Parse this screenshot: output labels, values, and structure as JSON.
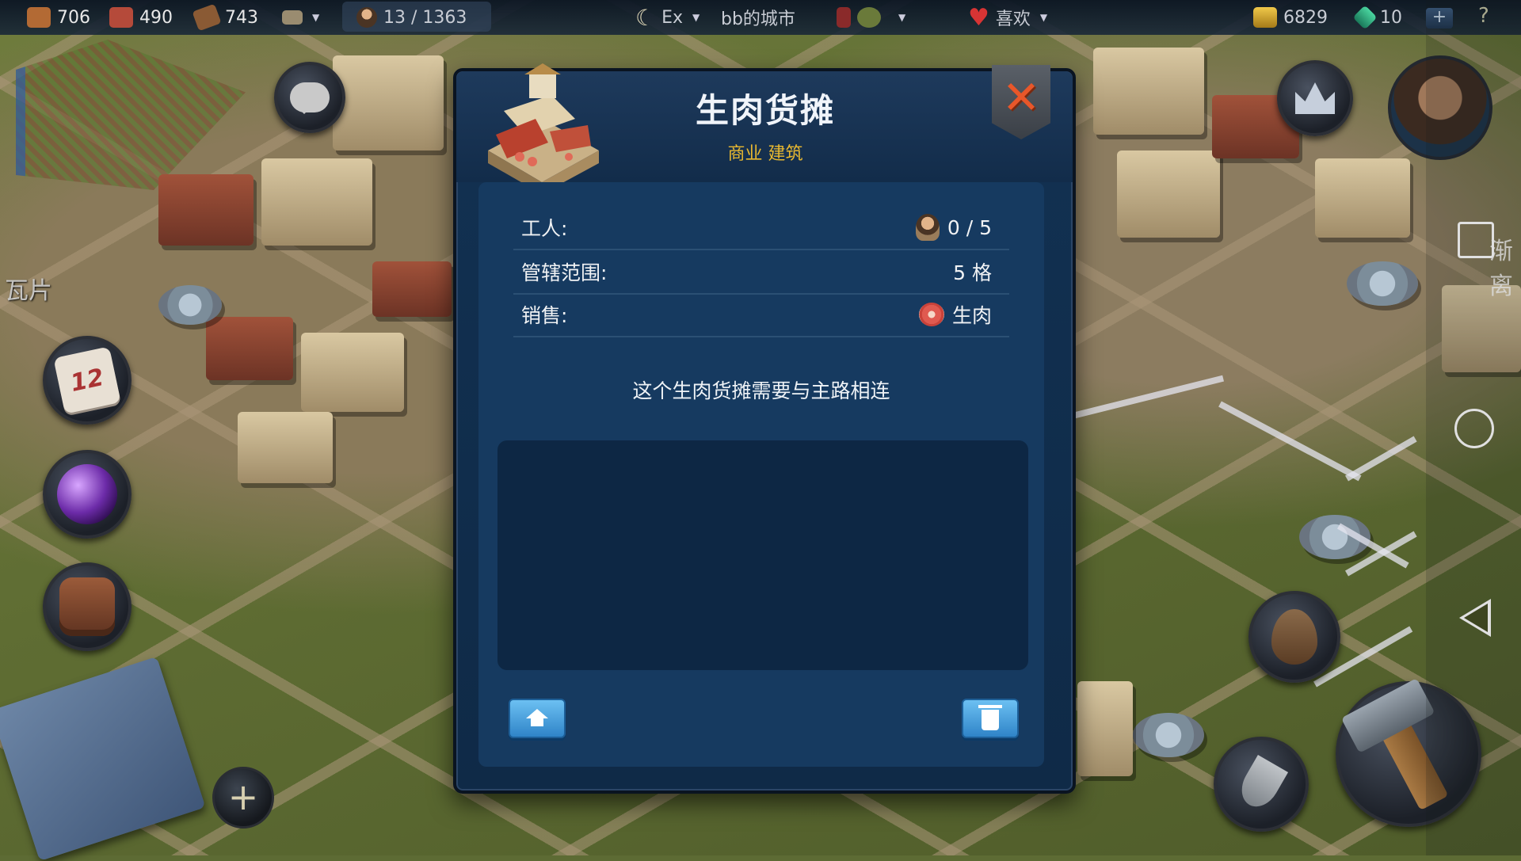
{
  "topbar": {
    "resources": [
      {
        "name": "wood-crate",
        "value": "706",
        "color": "#b36a34"
      },
      {
        "name": "brick",
        "value": "490",
        "color": "#b54a3a"
      },
      {
        "name": "log",
        "value": "743",
        "color": "#8a5a34"
      }
    ],
    "population": "13 / 1363",
    "difficulty": "Ex",
    "city_name": "bb的城市",
    "mood": "喜欢",
    "gold": "6829",
    "gems": "10",
    "add_label": "+",
    "help_label": "?"
  },
  "map": {
    "edge_label_left": "瓦片",
    "edge_label_right": "渐离"
  },
  "left_buttons": {
    "calendar_day": "12",
    "add_label": "+"
  },
  "dialog": {
    "title": "生肉货摊",
    "subtitle": "商业 建筑",
    "rows": [
      {
        "label": "工人:",
        "value": "0 / 5",
        "icon": "worker-icon"
      },
      {
        "label": "管辖范围:",
        "value": "5 格",
        "icon": ""
      },
      {
        "label": "销售:",
        "value": "生肉",
        "icon": "meat-icon"
      }
    ],
    "notice": "这个生肉货摊需要与主路相连",
    "close_glyph": "✕"
  },
  "colors": {
    "accent_gold": "#e8b830",
    "dialog_bg": "#123152",
    "close_orange": "#e8572a",
    "button_blue": "#3c9ad8"
  }
}
